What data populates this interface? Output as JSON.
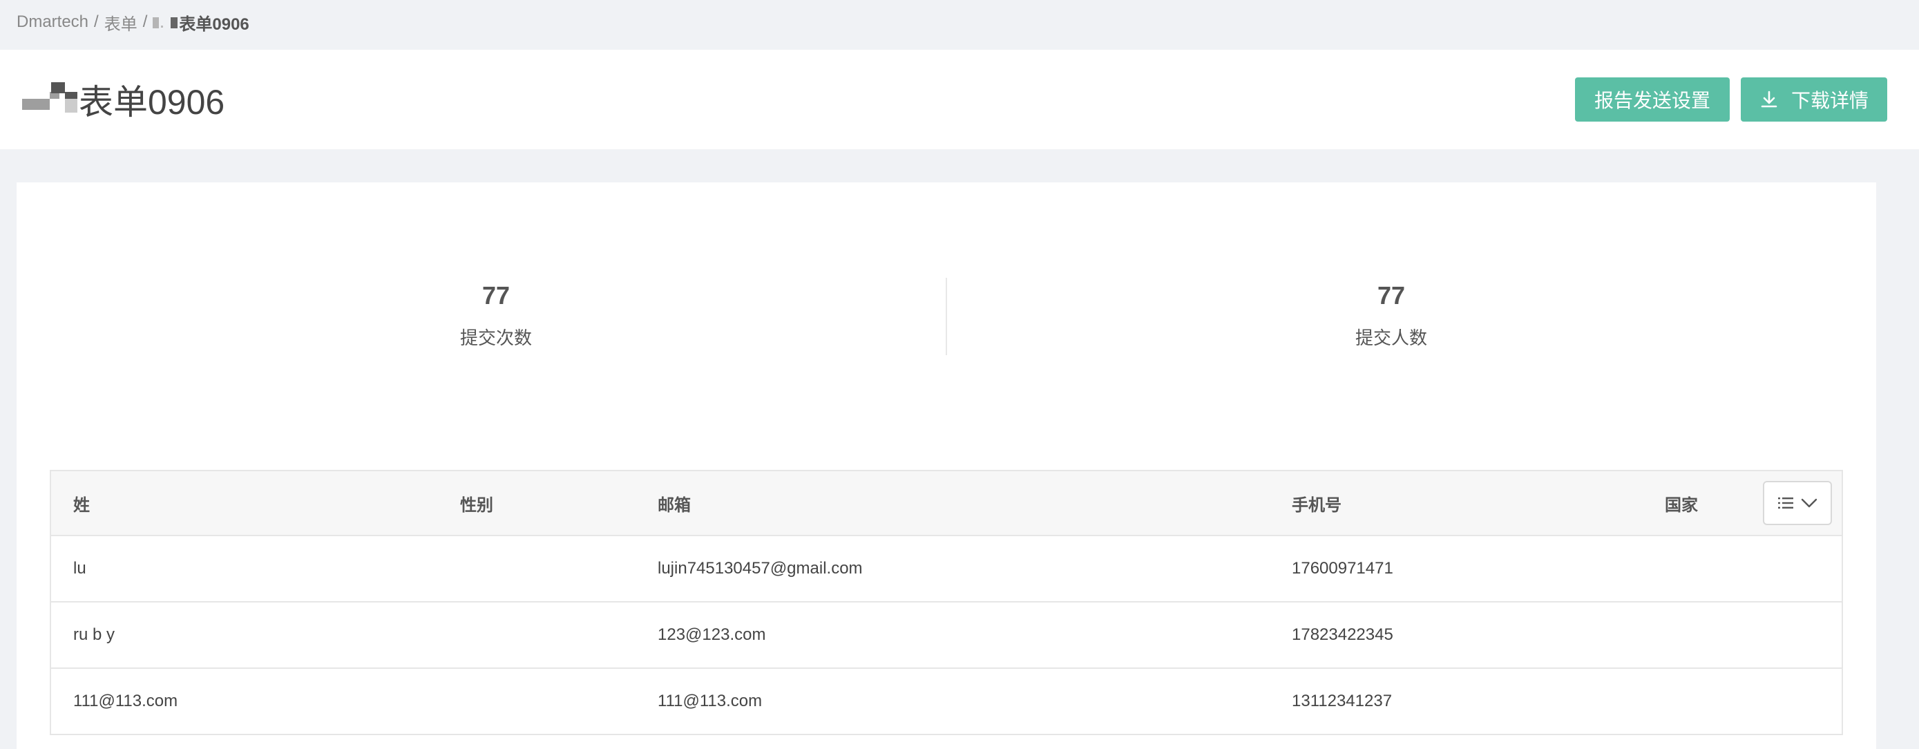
{
  "breadcrumb": {
    "items": [
      "Dmartech",
      "表单"
    ],
    "separator": "/",
    "current": "表单0906"
  },
  "page": {
    "title": "表单0906"
  },
  "actions": {
    "report_settings_label": "报告发送设置",
    "download_details_label": "下载详情"
  },
  "stats": {
    "submissions": {
      "value": "77",
      "label": "提交次数"
    },
    "submitters": {
      "value": "77",
      "label": "提交人数"
    }
  },
  "table": {
    "headers": [
      "姓",
      "性别",
      "邮箱",
      "手机号",
      "国家"
    ],
    "rows": [
      [
        "lu",
        "",
        "lujin745130457@gmail.com",
        "17600971471",
        ""
      ],
      [
        "ru b y",
        "",
        "123@123.com",
        "17823422345",
        ""
      ],
      [
        "111@113.com",
        "",
        "111@113.com",
        "13112341237",
        ""
      ]
    ]
  },
  "colors": {
    "accent": "#5bbfa5",
    "page_bg": "#f0f2f5",
    "header_row_bg": "#f7f7f7"
  },
  "icons": [
    "download-icon",
    "column-list-icon",
    "chevron-down-icon"
  ]
}
